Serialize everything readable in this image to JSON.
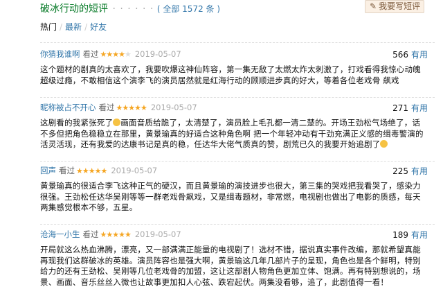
{
  "header": {
    "title": "破冰行动的短评",
    "dots": "· · · · · ·",
    "count": "( 全部 1572 条 )",
    "write_label": "我要写短评"
  },
  "filters": {
    "hot": "热门",
    "new": "最新",
    "friends": "好友",
    "separator": "/"
  },
  "comments": [
    {
      "user": "你猜我谁啊",
      "label": "看过",
      "rating": 4,
      "date": "2019-05-07",
      "votes": "566",
      "useful": "有用",
      "text": "这个题材的剧真的太喜欢了，我要吹爆这神仙阵容，第一集无敌了太燃太炸太刺激了，打戏看得我惊心动魄超级过瘾，不敢相信这个演李飞的演员居然就是红海行动的顾顺进步真的好大，等着各位老戏骨 飙戏"
    },
    {
      "user": "昵称被占不开心",
      "label": "看过",
      "rating": 5,
      "date": "2019-05-07",
      "votes": "271",
      "useful": "有用",
      "text": "这剧看的我紧张死了",
      "emoji1": "smile-emoji",
      "text2": "画面音质给跪了，太清楚了，演员脸上毛孔都一清二楚的。开场王劲松气场绝了，话不多但把角色稳稳立在那里，黄景瑜真的好适合这种角色啊 把一个年轻冲动有干劲充满正义感的缉毒警演的活灵活现，还有我爱的达康书记是真的稳，任达华大佬气质真的赞，剧荒已久的我要开始追剧了",
      "emoji2": "smile-emoji"
    },
    {
      "user": "回声",
      "label": "看过",
      "rating": 5,
      "date": "2019-05-07",
      "votes": "225",
      "useful": "有用",
      "text": "黄景瑜真的很适合李飞这种正气的硬汉，而且黄景瑜的演技进步也很大，第三集的哭戏把我看哭了，感染力很强。王劲松任达华吴刚等等一群老戏骨飙戏，又是缉毒题材，非常燃，电视剧也做出了电影的质感，每天两集感觉根本不够，五星。"
    },
    {
      "user": "沧海一小生",
      "label": "看过",
      "rating": 5,
      "date": "2019-05-07",
      "votes": "189",
      "useful": "有用",
      "text": "开局就这么热血沸腾，漂亮，又一部满满正能量的电视剧了！选材不错，据说真实事件改编，那就希望真能再现我们这群破冰的英雄。演员阵容也是强大啊，黄景瑜这几年几部片子的呈现，角色也是各个鲜明，特别给力的还有王劲松、吴刚等几位老戏骨的加盟，这让这部剧人物角色更加立体、饱满。再有特别想说的，场景、画面、音乐丝丝入微也让故事更加扣人心弦、跌宕起伏。两集没看够，追了，此剧值得一看！"
    }
  ]
}
